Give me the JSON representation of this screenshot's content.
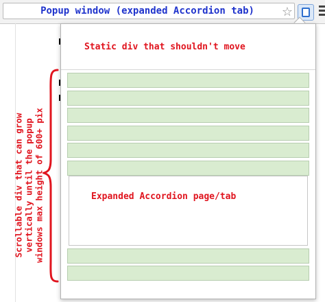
{
  "browser": {
    "window_title": "Popup window (expanded Accordion tab)",
    "star_icon": "star-icon",
    "extension_icon": "extension-icon",
    "menu_icon": "menu-icon"
  },
  "popup": {
    "static_div_text": "Static div that shouldn't move",
    "accordion": {
      "bars_above_count": 6,
      "expanded_panel_text": "Expanded Accordion page/tab",
      "bars_below_count": 2,
      "bar_color": "#d9ecd0"
    }
  },
  "annotation": {
    "lines": [
      "Scrollable div that can grow",
      "vertically until the popup",
      "windows max height of 600+ pix"
    ],
    "color": "#e0141e"
  }
}
